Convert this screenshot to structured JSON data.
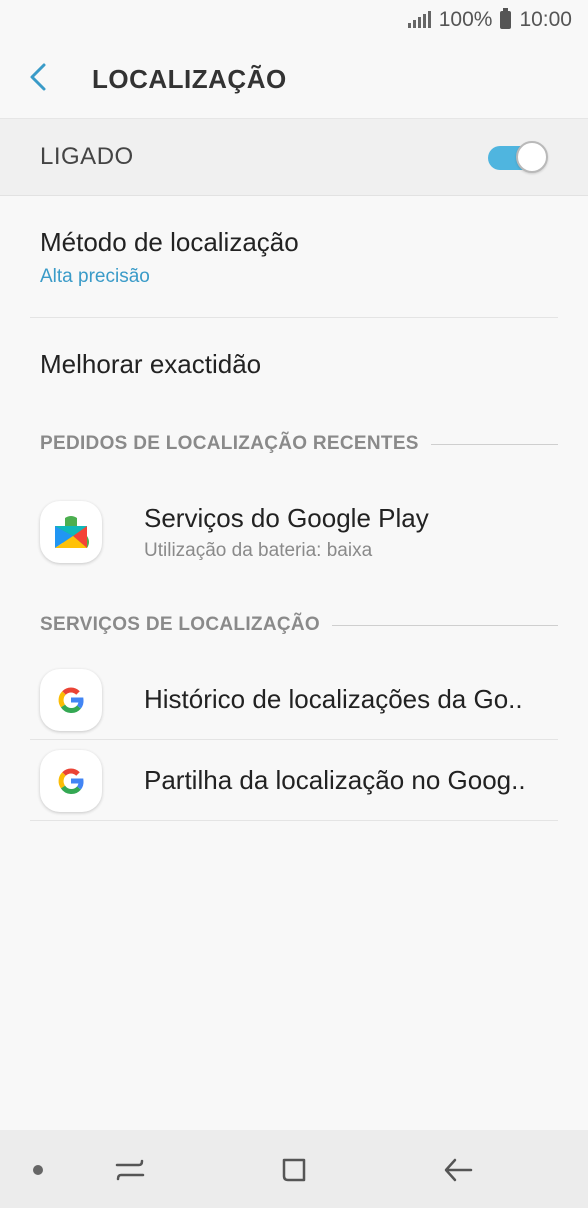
{
  "status_bar": {
    "battery_text": "100%",
    "time": "10:00"
  },
  "app_bar": {
    "title": "LOCALIZAÇÃO",
    "back_icon": "chevron-left-icon"
  },
  "master_switch": {
    "label": "LIGADO",
    "state": "on",
    "accent": "#4fb5df"
  },
  "settings": {
    "location_method": {
      "title": "Método de localização",
      "value": "Alta precisão",
      "value_color": "#3a9bc8"
    },
    "improve_accuracy": {
      "title": "Melhorar exactidão"
    }
  },
  "recent_requests": {
    "header": "PEDIDOS DE LOCALIZAÇÃO RECENTES",
    "items": [
      {
        "icon": "google-play-services-icon",
        "title": "Serviços do Google Play",
        "subtitle": "Utilização da bateria: baixa"
      }
    ]
  },
  "location_services": {
    "header": "SERVIÇOS DE LOCALIZAÇÃO",
    "items": [
      {
        "icon": "google-g-icon",
        "title": "Histórico de localizações da Go.."
      },
      {
        "icon": "google-g-icon",
        "title": "Partilha da localização no Goog.."
      }
    ]
  },
  "nav_bar": {
    "buttons": [
      "dot-icon",
      "recents-icon",
      "home-icon",
      "back-arrow-icon"
    ]
  }
}
